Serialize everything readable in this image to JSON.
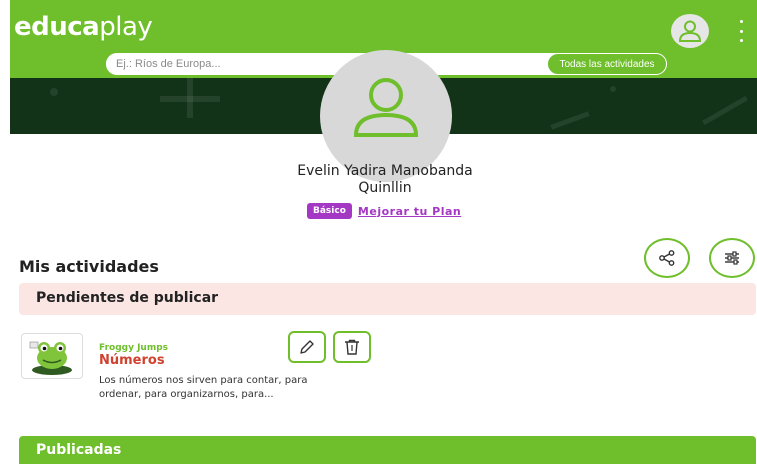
{
  "header": {
    "logo_bold": "educa",
    "logo_light": "play"
  },
  "search": {
    "placeholder": "Ej.: Ríos de Europa...",
    "all_activities": "Todas las actividades"
  },
  "profile": {
    "name_line1": "Evelin Yadira Manobanda",
    "name_line2": "Quinllin",
    "plan_badge": "Básico",
    "upgrade_link": "Mejorar tu Plan"
  },
  "activities": {
    "title": "Mis actividades",
    "pending_label": "Pendientes de publicar",
    "published_label": "Publicadas",
    "items": [
      {
        "type": "Froggy Jumps",
        "name": "Números",
        "description_line1": "Los números nos sirven para contar, para",
        "description_line2": "ordenar, para organizarnos, para..."
      }
    ]
  },
  "colors": {
    "brand_green": "#6fbe2c",
    "banner_dark": "#123318",
    "plan_purple": "#a437c4",
    "pending_bg": "#fbe6e4",
    "activity_name_red": "#d0412f"
  },
  "icons": [
    "user-icon",
    "kebab-menu-icon",
    "search-icon",
    "share-icon",
    "filter-icon",
    "edit-icon",
    "delete-icon",
    "froggy-jumps-thumbnail"
  ]
}
